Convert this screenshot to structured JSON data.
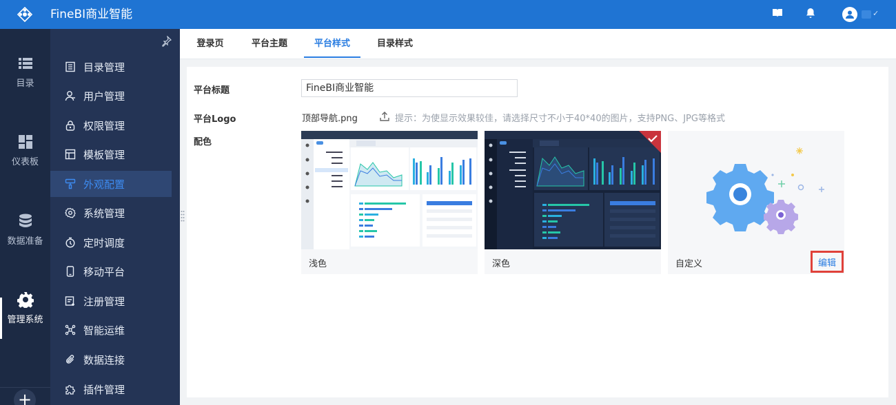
{
  "app": {
    "title": "FineBI商业智能"
  },
  "rail": {
    "items": [
      {
        "label": "目录"
      },
      {
        "label": "仪表板"
      },
      {
        "label": "数据准备"
      },
      {
        "label": "管理系统"
      }
    ],
    "add_label": "+"
  },
  "submenu": {
    "items": [
      {
        "label": "目录管理"
      },
      {
        "label": "用户管理"
      },
      {
        "label": "权限管理"
      },
      {
        "label": "模板管理"
      },
      {
        "label": "外观配置"
      },
      {
        "label": "系统管理"
      },
      {
        "label": "定时调度"
      },
      {
        "label": "移动平台"
      },
      {
        "label": "注册管理"
      },
      {
        "label": "智能运维"
      },
      {
        "label": "数据连接"
      },
      {
        "label": "插件管理"
      }
    ],
    "active_index": 4
  },
  "tabs": [
    {
      "label": "登录页"
    },
    {
      "label": "平台主题"
    },
    {
      "label": "平台样式"
    },
    {
      "label": "目录样式"
    }
  ],
  "form": {
    "title_label": "平台标题",
    "title_value": "FineBI商业智能",
    "logo_label": "平台Logo",
    "logo_file": "顶部导航.png",
    "logo_hint": "提示：为使显示效果较佳，请选择尺寸不小于40*40的图片，支持PNG、JPG等格式",
    "color_label": "配色"
  },
  "themes": [
    {
      "caption": "浅色"
    },
    {
      "caption": "深色",
      "selected": true
    },
    {
      "caption": "自定义",
      "edit_label": "编辑"
    }
  ],
  "colors": {
    "topbar": "#1f74d3",
    "rail": "#1c2a44",
    "submenu": "#243455",
    "accent": "#2a7de1",
    "highlight": "#e0413a"
  }
}
